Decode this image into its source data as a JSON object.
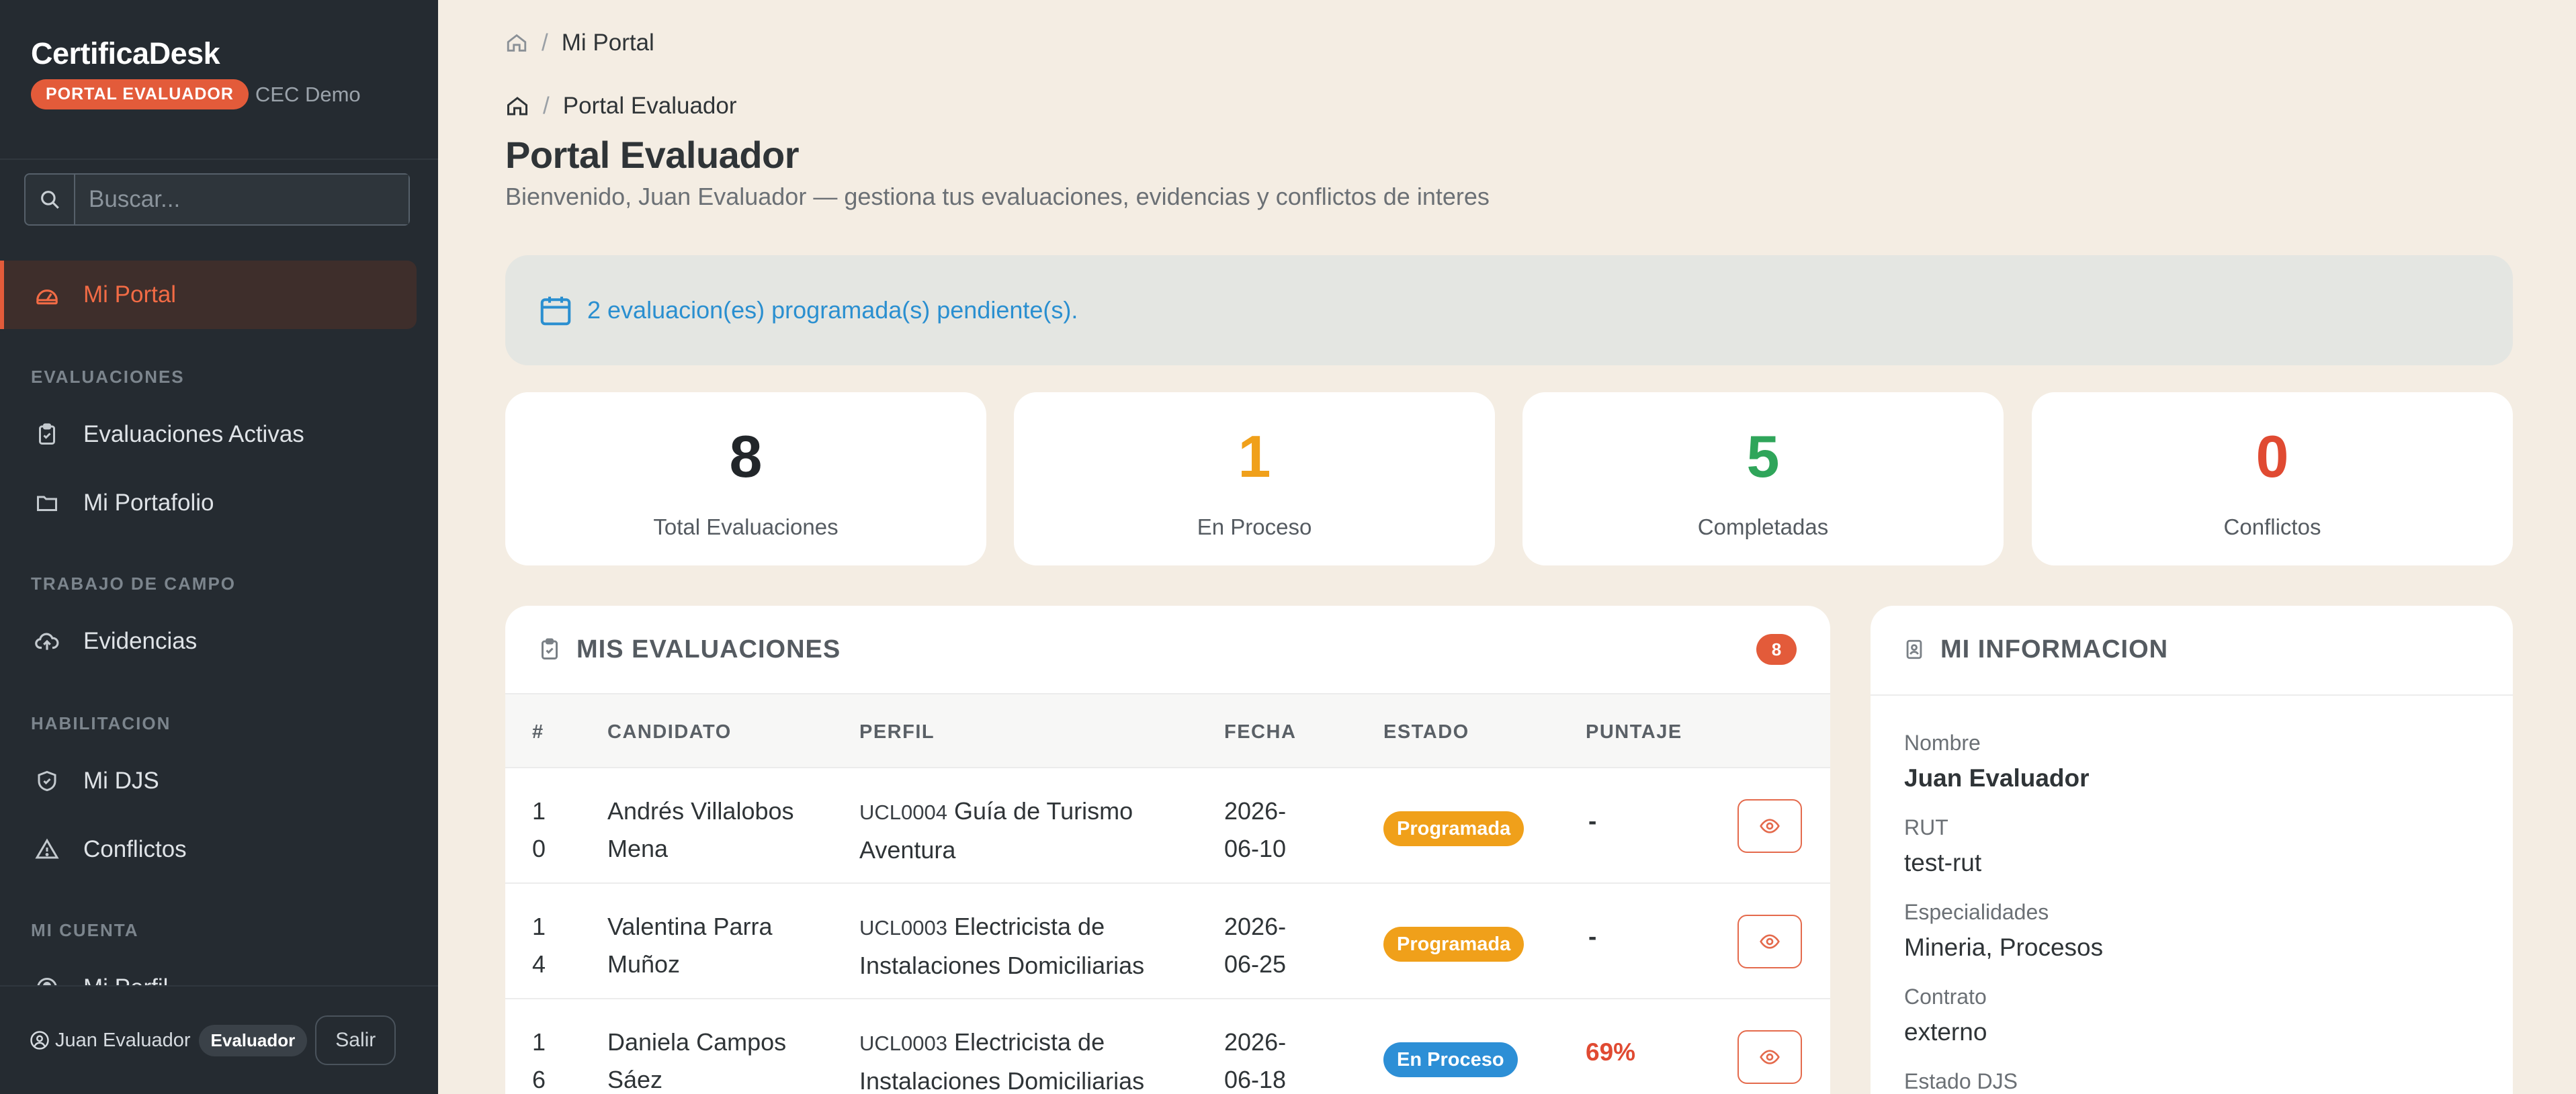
{
  "sidebar": {
    "brand": "CertificaDesk",
    "portal_badge": "PORTAL EVALUADOR",
    "org": "CEC Demo",
    "search_placeholder": "Buscar...",
    "active_item": "Mi Portal",
    "sections": {
      "evaluaciones": "EVALUACIONES",
      "trabajo": "TRABAJO DE CAMPO",
      "habilitacion": "HABILITACION",
      "cuenta": "MI CUENTA"
    },
    "items": {
      "activas": "Evaluaciones Activas",
      "portafolio": "Mi Portafolio",
      "evidencias": "Evidencias",
      "djs": "Mi DJS",
      "conflictos": "Conflictos",
      "perfil": "Mi Perfil"
    },
    "footer": {
      "user": "Juan Evaluador",
      "role": "Evaluador",
      "logout": "Salir"
    }
  },
  "breadcrumb_top": {
    "current": "Mi Portal"
  },
  "breadcrumb_page": {
    "current": "Portal Evaluador"
  },
  "page": {
    "title": "Portal Evaluador",
    "subtitle": "Bienvenido, Juan Evaluador — gestiona tus evaluaciones, evidencias y conflictos de interes"
  },
  "alert": "2 evaluacion(es) programada(s) pendiente(s).",
  "stats": [
    {
      "value": "8",
      "label": "Total Evaluaciones",
      "color": "#22262a"
    },
    {
      "value": "1",
      "label": "En Proceso",
      "color": "#f0a01a"
    },
    {
      "value": "5",
      "label": "Completadas",
      "color": "#2fa55a"
    },
    {
      "value": "0",
      "label": "Conflictos",
      "color": "#e04a32"
    }
  ],
  "evaluations": {
    "title": "MIS EVALUACIONES",
    "count": "8",
    "headers": [
      "#",
      "CANDIDATO",
      "PERFIL",
      "FECHA",
      "ESTADO",
      "PUNTAJE"
    ],
    "rows": [
      {
        "id1": "1",
        "id2": "0",
        "cand1": "Andrés Villalobos",
        "cand2": "Mena",
        "code": "UCL0004",
        "perf1": "Guía de Turismo",
        "perf2": "Aventura",
        "date1": "2026-",
        "date2": "06-10",
        "status": "Programada",
        "score": "-"
      },
      {
        "id1": "1",
        "id2": "4",
        "cand1": "Valentina Parra",
        "cand2": "Muñoz",
        "code": "UCL0003",
        "perf1": "Electricista de",
        "perf2": "Instalaciones Domiciliarias",
        "date1": "2026-",
        "date2": "06-25",
        "status": "Programada",
        "score": "-"
      },
      {
        "id1": "1",
        "id2": "6",
        "cand1": "Daniela Campos",
        "cand2": "Sáez",
        "code": "UCL0003",
        "perf1": "Electricista de",
        "perf2": "Instalaciones Domiciliarias",
        "date1": "2026-",
        "date2": "06-18",
        "status": "En Proceso",
        "score": "69%"
      }
    ]
  },
  "info": {
    "title": "MI INFORMACION",
    "fields": [
      {
        "label": "Nombre",
        "value": "Juan Evaluador"
      },
      {
        "label": "RUT",
        "value": "test-rut"
      },
      {
        "label": "Especialidades",
        "value": "Mineria, Procesos"
      },
      {
        "label": "Contrato",
        "value": "externo"
      },
      {
        "label": "Estado DJS",
        "value": ""
      }
    ]
  }
}
